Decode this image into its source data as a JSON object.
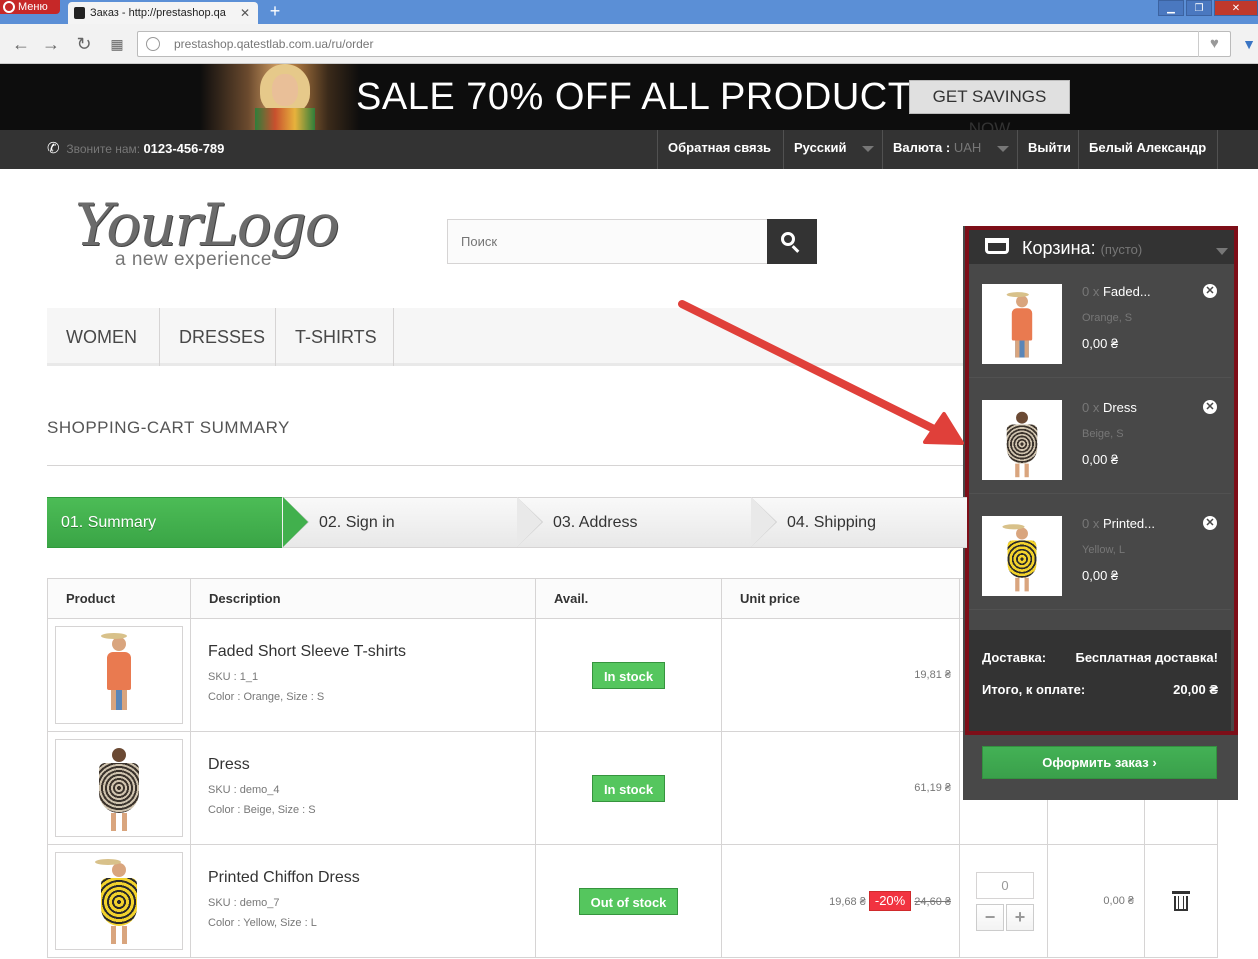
{
  "browser": {
    "menu_label": "Меню",
    "tab_title": "Заказ - http://prestashop.qa",
    "url_host": "prestashop.qatestlab.com.ua",
    "url_path": "/ru/order"
  },
  "banner": {
    "text": "SALE 70% OFF ALL PRODUCTS",
    "button": "GET SAVINGS NOW"
  },
  "topnav": {
    "phone_label": "Звоните нам:",
    "phone_number": "0123-456-789",
    "contact": "Обратная связь",
    "language": "Русский",
    "currency_label": "Валюта :",
    "currency_value": "UAH",
    "logout": "Выйти",
    "user": "Белый Александр"
  },
  "header": {
    "logo_main": "YourLogo",
    "logo_sub": "a new experience",
    "search_placeholder": "Поиск"
  },
  "menu": [
    "WOMEN",
    "DRESSES",
    "T-SHIRTS"
  ],
  "page": {
    "heading": "SHOPPING-CART SUMMARY"
  },
  "steps": [
    "01. Summary",
    "02. Sign in",
    "03. Address",
    "04. Shipping"
  ],
  "table": {
    "headers": [
      "Product",
      "Description",
      "Avail.",
      "Unit price"
    ],
    "rows": [
      {
        "name": "Faded Short Sleeve T-shirts",
        "sku": "SKU : 1_1",
        "attrs": "Color : Orange, Size : S",
        "avail": "In stock",
        "price": "19,81 ₴"
      },
      {
        "name": "Dress",
        "sku": "SKU : demo_4",
        "attrs": "Color : Beige, Size : S",
        "avail": "In stock",
        "price": "61,19 ₴"
      },
      {
        "name": "Printed Chiffon Dress",
        "sku": "SKU : demo_7",
        "attrs": "Color : Yellow, Size : L",
        "avail": "Out of stock",
        "price": "19,68 ₴",
        "discount": "-20%",
        "old_price": "24,60 ₴",
        "qty": "0",
        "total": "0,00 ₴"
      }
    ]
  },
  "cart": {
    "title": "Корзина:",
    "status": "(пусто)",
    "items": [
      {
        "qty": "0 x",
        "name": "Faded...",
        "attrs": "Orange, S",
        "price": "0,00 ₴"
      },
      {
        "qty": "0 x",
        "name": "Dress",
        "attrs": "Beige, S",
        "price": "0,00 ₴"
      },
      {
        "qty": "0 x",
        "name": "Printed...",
        "attrs": "Yellow, L",
        "price": "0,00 ₴"
      }
    ],
    "shipping_label": "Доставка:",
    "shipping_value": "Бесплатная доставка!",
    "total_label": "Итого, к оплате:",
    "total_value": "20,00 ₴",
    "checkout": "Оформить заказ"
  },
  "colors": {
    "accent_green": "#46a74e",
    "annotation_red": "#e0403a",
    "frame_red": "#7d0e18"
  }
}
